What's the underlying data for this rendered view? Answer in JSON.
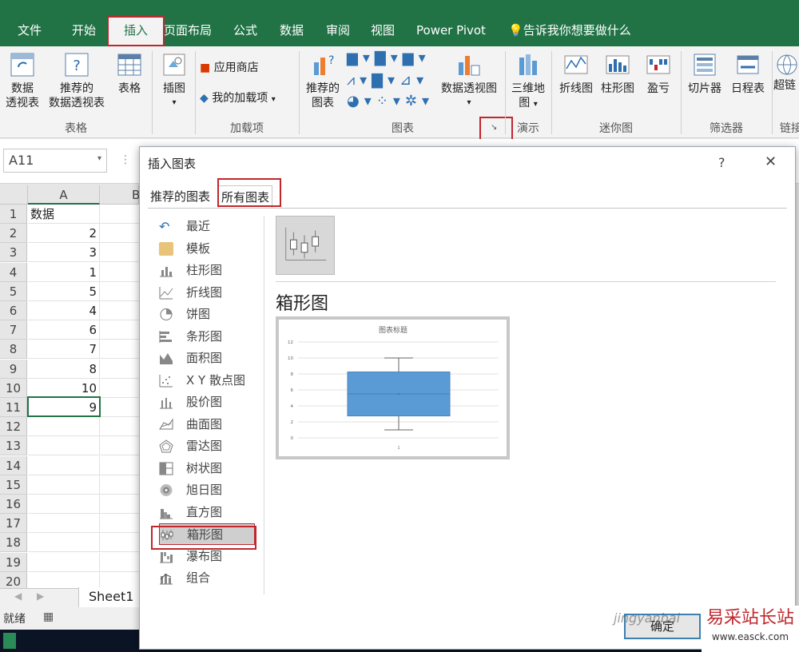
{
  "colors": {
    "excel_green": "#217346",
    "accent_red": "#c0272d",
    "box_fill": "#5b9bd5"
  },
  "tabs": [
    "文件",
    "开始",
    "插入",
    "页面布局",
    "公式",
    "数据",
    "审阅",
    "视图",
    "Power Pivot"
  ],
  "tell_me": "告诉我你想要做什么",
  "ribbon": {
    "pivot_table": [
      "数据",
      "透视表"
    ],
    "recommended_pivot": [
      "推荐的",
      "数据透视表"
    ],
    "table": "表格",
    "illustrations": "插图",
    "store": "应用商店",
    "my_addins": "我的加载项",
    "recommended_charts": [
      "推荐的",
      "图表"
    ],
    "pivot_chart": "数据透视图",
    "map3d": [
      "三维地",
      "图"
    ],
    "line": "折线图",
    "column": "柱形图",
    "winloss": "盈亏",
    "slicer": "切片器",
    "timeline": "日程表",
    "hyperlink": "超链",
    "groups": {
      "tables": "表格",
      "addins": "加载项",
      "charts": "图表",
      "tours": "演示",
      "sparklines": "迷你图",
      "filters": "筛选器",
      "links": "链接"
    }
  },
  "name_box": "A11",
  "columns": [
    "A",
    "B"
  ],
  "rows": [
    "1",
    "2",
    "3",
    "4",
    "5",
    "6",
    "7",
    "8",
    "9",
    "10",
    "11",
    "12",
    "13",
    "14",
    "15",
    "16",
    "17",
    "18",
    "19",
    "20"
  ],
  "cells": [
    "数据",
    "2",
    "3",
    "1",
    "5",
    "4",
    "6",
    "7",
    "8",
    "10",
    "9",
    "",
    "",
    "",
    "",
    "",
    "",
    "",
    "",
    ""
  ],
  "sheet_tab": "Sheet1",
  "status": "就绪",
  "dialog": {
    "title": "插入图表",
    "help": "?",
    "close": "✕",
    "tabs": [
      "推荐的图表",
      "所有图表"
    ],
    "categories": [
      "最近",
      "模板",
      "柱形图",
      "折线图",
      "饼图",
      "条形图",
      "面积图",
      "X Y 散点图",
      "股价图",
      "曲面图",
      "雷达图",
      "树状图",
      "旭日图",
      "直方图",
      "箱形图",
      "瀑布图",
      "组合"
    ],
    "selected_category": "箱形图",
    "section_title": "箱形图",
    "ok": "确定"
  },
  "chart_data": {
    "type": "box",
    "title": "图表标题",
    "categories": [
      "1"
    ],
    "yticks": [
      "0",
      "2",
      "4",
      "6",
      "8",
      "10",
      "12"
    ],
    "ylim": [
      0,
      12
    ],
    "box": {
      "min": 1,
      "q1": 2.75,
      "median": 5.5,
      "mean": 5.5,
      "q3": 8.25,
      "max": 10
    }
  },
  "watermark": {
    "text": "易采站长站",
    "url": "www.easck.com",
    "jy": "jingyanbai"
  }
}
